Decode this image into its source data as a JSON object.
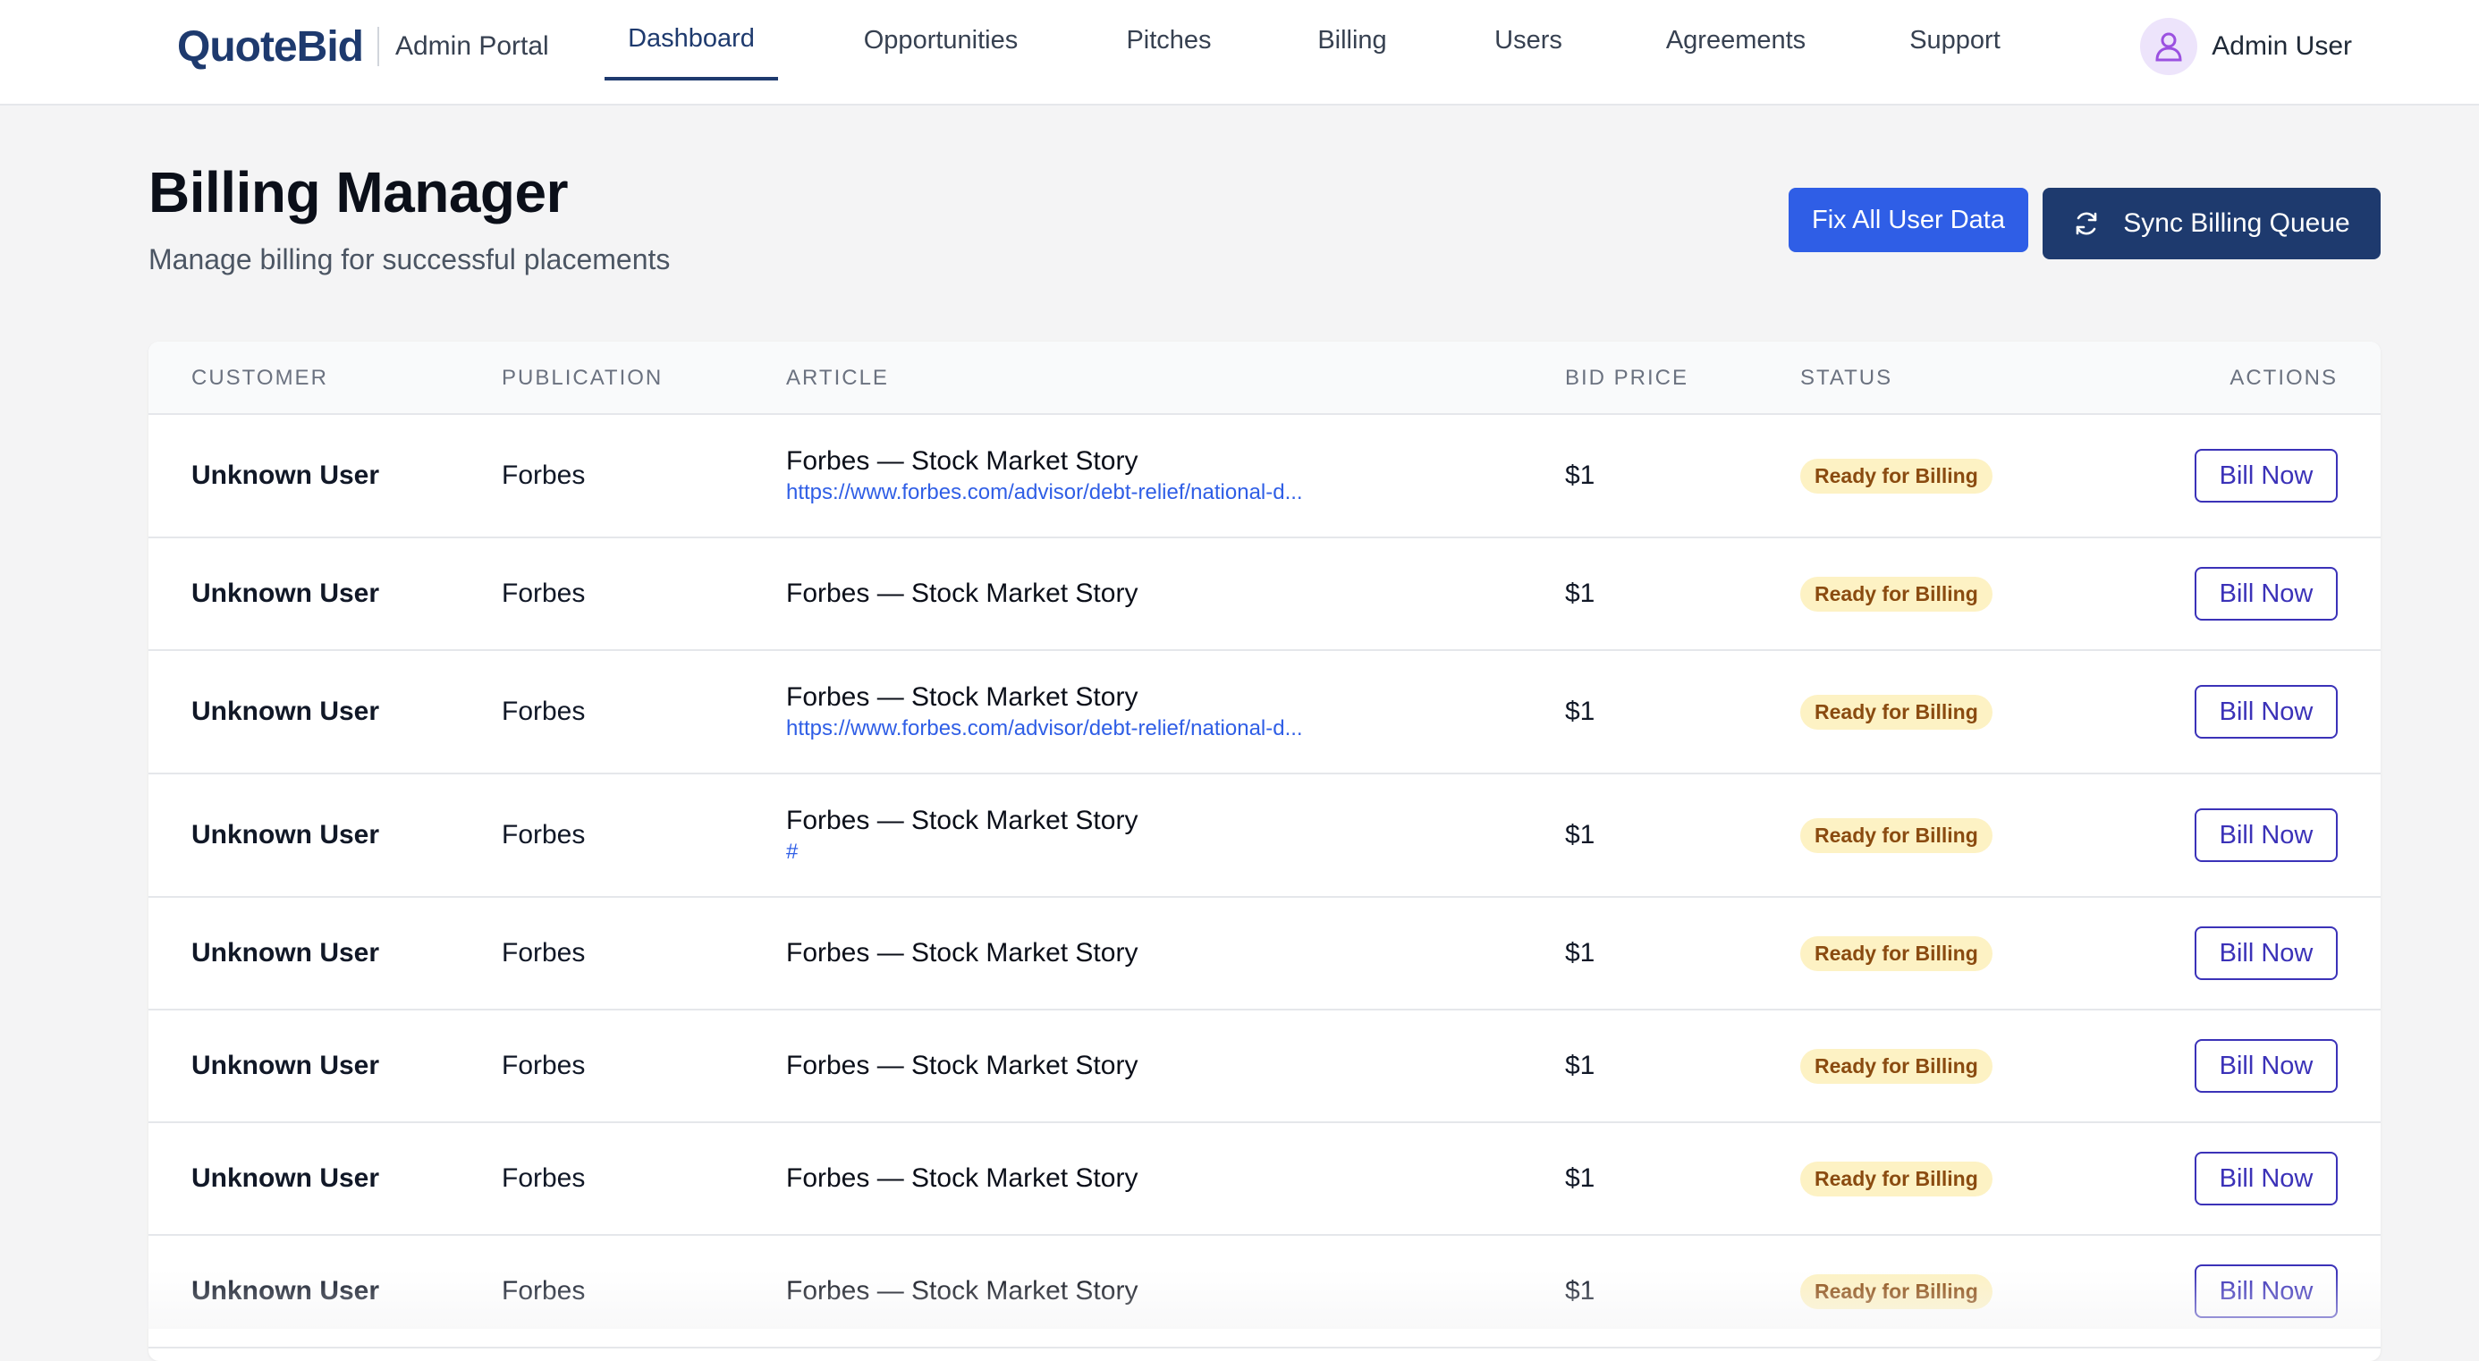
{
  "header": {
    "brand": "QuoteBid",
    "portal_label": "Admin Portal",
    "nav": [
      {
        "label": "Dashboard",
        "active": true
      },
      {
        "label": "Opportunities",
        "active": false
      },
      {
        "label": "Pitches",
        "active": false
      },
      {
        "label": "Billing",
        "active": false
      },
      {
        "label": "Users",
        "active": false
      },
      {
        "label": "Agreements",
        "active": false
      },
      {
        "label": "Support",
        "active": false
      }
    ],
    "user_name": "Admin User",
    "user_icon": "user-icon"
  },
  "page": {
    "title": "Billing Manager",
    "subtitle": "Manage billing for successful placements",
    "fix_button": "Fix All User Data",
    "sync_button": "Sync Billing Queue",
    "sync_icon": "refresh-icon"
  },
  "colors": {
    "brand": "#1e3a6e",
    "primary_blue": "#2f5ee6",
    "badge_bg": "#fdf2c4",
    "badge_text": "#8a4b10",
    "bill_button": "#3b32b8"
  },
  "table": {
    "columns": {
      "customer": "Customer",
      "publication": "Publication",
      "article": "Article",
      "price": "Bid Price",
      "status": "Status",
      "actions": "Actions"
    },
    "rows": [
      {
        "customer": "Unknown User",
        "publication": "Forbes",
        "article": "Forbes — Stock Market Story",
        "link": "https://www.forbes.com/advisor/debt-relief/national-d...",
        "price": "$1",
        "status": "Ready for Billing",
        "action": "Bill Now"
      },
      {
        "customer": "Unknown User",
        "publication": "Forbes",
        "article": "Forbes — Stock Market Story",
        "link": "",
        "price": "$1",
        "status": "Ready for Billing",
        "action": "Bill Now"
      },
      {
        "customer": "Unknown User",
        "publication": "Forbes",
        "article": "Forbes — Stock Market Story",
        "link": "https://www.forbes.com/advisor/debt-relief/national-d...",
        "price": "$1",
        "status": "Ready for Billing",
        "action": "Bill Now"
      },
      {
        "customer": "Unknown User",
        "publication": "Forbes",
        "article": "Forbes — Stock Market Story",
        "link": "#",
        "price": "$1",
        "status": "Ready for Billing",
        "action": "Bill Now"
      },
      {
        "customer": "Unknown User",
        "publication": "Forbes",
        "article": "Forbes — Stock Market Story",
        "link": "",
        "price": "$1",
        "status": "Ready for Billing",
        "action": "Bill Now"
      },
      {
        "customer": "Unknown User",
        "publication": "Forbes",
        "article": "Forbes — Stock Market Story",
        "link": "",
        "price": "$1",
        "status": "Ready for Billing",
        "action": "Bill Now"
      },
      {
        "customer": "Unknown User",
        "publication": "Forbes",
        "article": "Forbes — Stock Market Story",
        "link": "",
        "price": "$1",
        "status": "Ready for Billing",
        "action": "Bill Now"
      },
      {
        "customer": "Unknown User",
        "publication": "Forbes",
        "article": "Forbes — Stock Market Story",
        "link": "",
        "price": "$1",
        "status": "Ready for Billing",
        "action": "Bill Now"
      }
    ]
  }
}
